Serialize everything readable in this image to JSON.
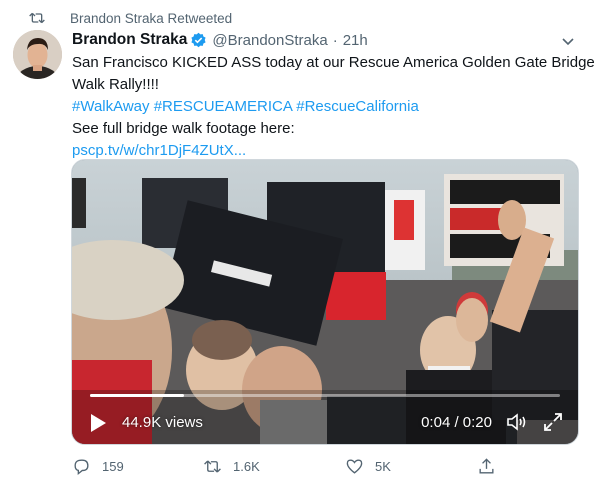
{
  "retweet": {
    "text": "Brandon Straka Retweeted",
    "icon": "retweet-icon"
  },
  "tweet": {
    "author_name": "Brandon Straka",
    "handle": "@BrandonStraka",
    "separator": "·",
    "time": "21h",
    "lines": [
      "San Francisco KICKED ASS today at our Rescue America Golden Gate Bridge",
      "Walk Rally!!!!"
    ],
    "hashtags": "#WalkAway #RESCUEAMERICA #RescueCalifornia",
    "footage_line": "See full bridge walk footage here:",
    "link_text": "pscp.tv/w/chr1DjF4ZUtX..."
  },
  "video": {
    "views": "44.9K views",
    "time": "0:04 / 0:20",
    "progress": 0.2
  },
  "actions": {
    "replies": "159",
    "retweets": "1.6K",
    "likes": "5K"
  },
  "colors": {
    "link": "#1d9bf0",
    "muted": "#536471",
    "text": "#0f1419"
  }
}
